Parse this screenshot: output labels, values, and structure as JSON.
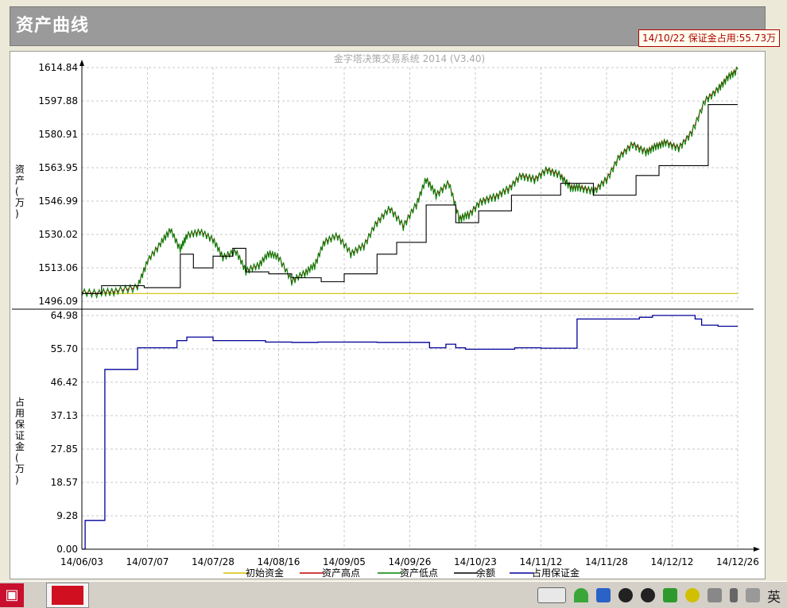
{
  "window": {
    "title": "资产曲线",
    "margin_badge": "14/10/22 保证金占用:55.73万"
  },
  "chart_data": {
    "type": "line",
    "subtitle": "金字塔决策交易系统 2014 (V3.40)",
    "x_ticks": [
      "14/06/03",
      "14/07/07",
      "14/07/28",
      "14/08/16",
      "14/09/05",
      "14/09/26",
      "14/10/23",
      "14/11/12",
      "14/11/28",
      "14/12/12",
      "14/12/26"
    ],
    "legend": [
      {
        "name": "初始资金",
        "color": "#d4c000"
      },
      {
        "name": "资产高点",
        "color": "#c00000"
      },
      {
        "name": "资产低点",
        "color": "#008000"
      },
      {
        "name": "余额",
        "color": "#000000"
      },
      {
        "name": "占用保证金",
        "color": "#000099"
      }
    ],
    "upper": {
      "ylabel": "资产(万)",
      "ylim": [
        1496.09,
        1614.84
      ],
      "y_ticks": [
        "1614.84",
        "1597.88",
        "1580.91",
        "1563.95",
        "1546.99",
        "1530.02",
        "1513.06",
        "1496.09"
      ],
      "initial_capital": 1500,
      "asset_curve_t": [
        0,
        0.03,
        0.055,
        0.085,
        0.1,
        0.12,
        0.135,
        0.15,
        0.16,
        0.18,
        0.2,
        0.215,
        0.235,
        0.25,
        0.27,
        0.285,
        0.3,
        0.32,
        0.34,
        0.355,
        0.37,
        0.39,
        0.41,
        0.43,
        0.45,
        0.47,
        0.49,
        0.51,
        0.525,
        0.54,
        0.56,
        0.575,
        0.59,
        0.61,
        0.63,
        0.65,
        0.67,
        0.69,
        0.71,
        0.73,
        0.745,
        0.76,
        0.78,
        0.8,
        0.82,
        0.84,
        0.86,
        0.875,
        0.89,
        0.91,
        0.93,
        0.95,
        0.97,
        0.985,
        1.0
      ],
      "asset_curve_v": [
        1500,
        1500,
        1501,
        1503,
        1516,
        1525,
        1532,
        1522,
        1529,
        1531,
        1527,
        1518,
        1521,
        1511,
        1514,
        1520,
        1518,
        1506,
        1510,
        1514,
        1526,
        1529,
        1520,
        1524,
        1536,
        1543,
        1534,
        1545,
        1558,
        1550,
        1556,
        1538,
        1540,
        1547,
        1549,
        1553,
        1560,
        1558,
        1563,
        1560,
        1554,
        1554,
        1552,
        1558,
        1570,
        1576,
        1572,
        1575,
        1577,
        1574,
        1582,
        1598,
        1604,
        1610,
        1614
      ],
      "balance_curve_t": [
        0,
        0.03,
        0.03,
        0.095,
        0.095,
        0.15,
        0.15,
        0.17,
        0.17,
        0.2,
        0.2,
        0.23,
        0.23,
        0.25,
        0.25,
        0.285,
        0.285,
        0.32,
        0.32,
        0.365,
        0.365,
        0.4,
        0.4,
        0.45,
        0.45,
        0.48,
        0.48,
        0.525,
        0.525,
        0.57,
        0.57,
        0.605,
        0.605,
        0.655,
        0.655,
        0.73,
        0.73,
        0.78,
        0.78,
        0.845,
        0.845,
        0.88,
        0.88,
        0.955,
        0.955,
        1.0
      ],
      "balance_curve_v": [
        1500,
        1500,
        1504,
        1504,
        1503,
        1503,
        1520,
        1520,
        1513,
        1513,
        1519,
        1519,
        1523,
        1523,
        1511,
        1511,
        1510,
        1510,
        1508,
        1508,
        1506,
        1506,
        1510,
        1510,
        1520,
        1520,
        1526,
        1526,
        1545,
        1545,
        1536,
        1536,
        1542,
        1542,
        1550,
        1550,
        1556,
        1556,
        1550,
        1550,
        1560,
        1560,
        1565,
        1565,
        1596,
        1596
      ]
    },
    "lower": {
      "ylabel": "占用保证金(万)",
      "ylim": [
        0,
        64.98
      ],
      "y_ticks": [
        "64.98",
        "55.70",
        "46.42",
        "37.13",
        "27.85",
        "18.57",
        "9.28",
        "0.00"
      ],
      "margin_curve_t": [
        0,
        0.005,
        0.005,
        0.035,
        0.035,
        0.085,
        0.085,
        0.145,
        0.145,
        0.16,
        0.16,
        0.2,
        0.2,
        0.225,
        0.225,
        0.28,
        0.28,
        0.32,
        0.32,
        0.36,
        0.36,
        0.45,
        0.45,
        0.53,
        0.53,
        0.555,
        0.555,
        0.57,
        0.57,
        0.585,
        0.585,
        0.66,
        0.66,
        0.7,
        0.7,
        0.755,
        0.755,
        0.85,
        0.85,
        0.87,
        0.87,
        0.935,
        0.935,
        0.945,
        0.945,
        0.97,
        0.97,
        1.0
      ],
      "margin_curve_v": [
        0,
        0,
        8,
        8,
        50,
        50,
        56,
        56,
        58,
        58,
        59,
        59,
        58,
        58,
        58,
        58,
        57.6,
        57.6,
        57.5,
        57.5,
        57.6,
        57.6,
        57.5,
        57.5,
        56,
        56,
        57,
        57,
        56,
        56,
        55.6,
        55.6,
        56,
        56,
        55.9,
        55.9,
        64,
        64,
        64.5,
        64.5,
        65,
        65,
        64,
        64,
        62.3,
        62.3,
        62,
        62
      ]
    }
  }
}
